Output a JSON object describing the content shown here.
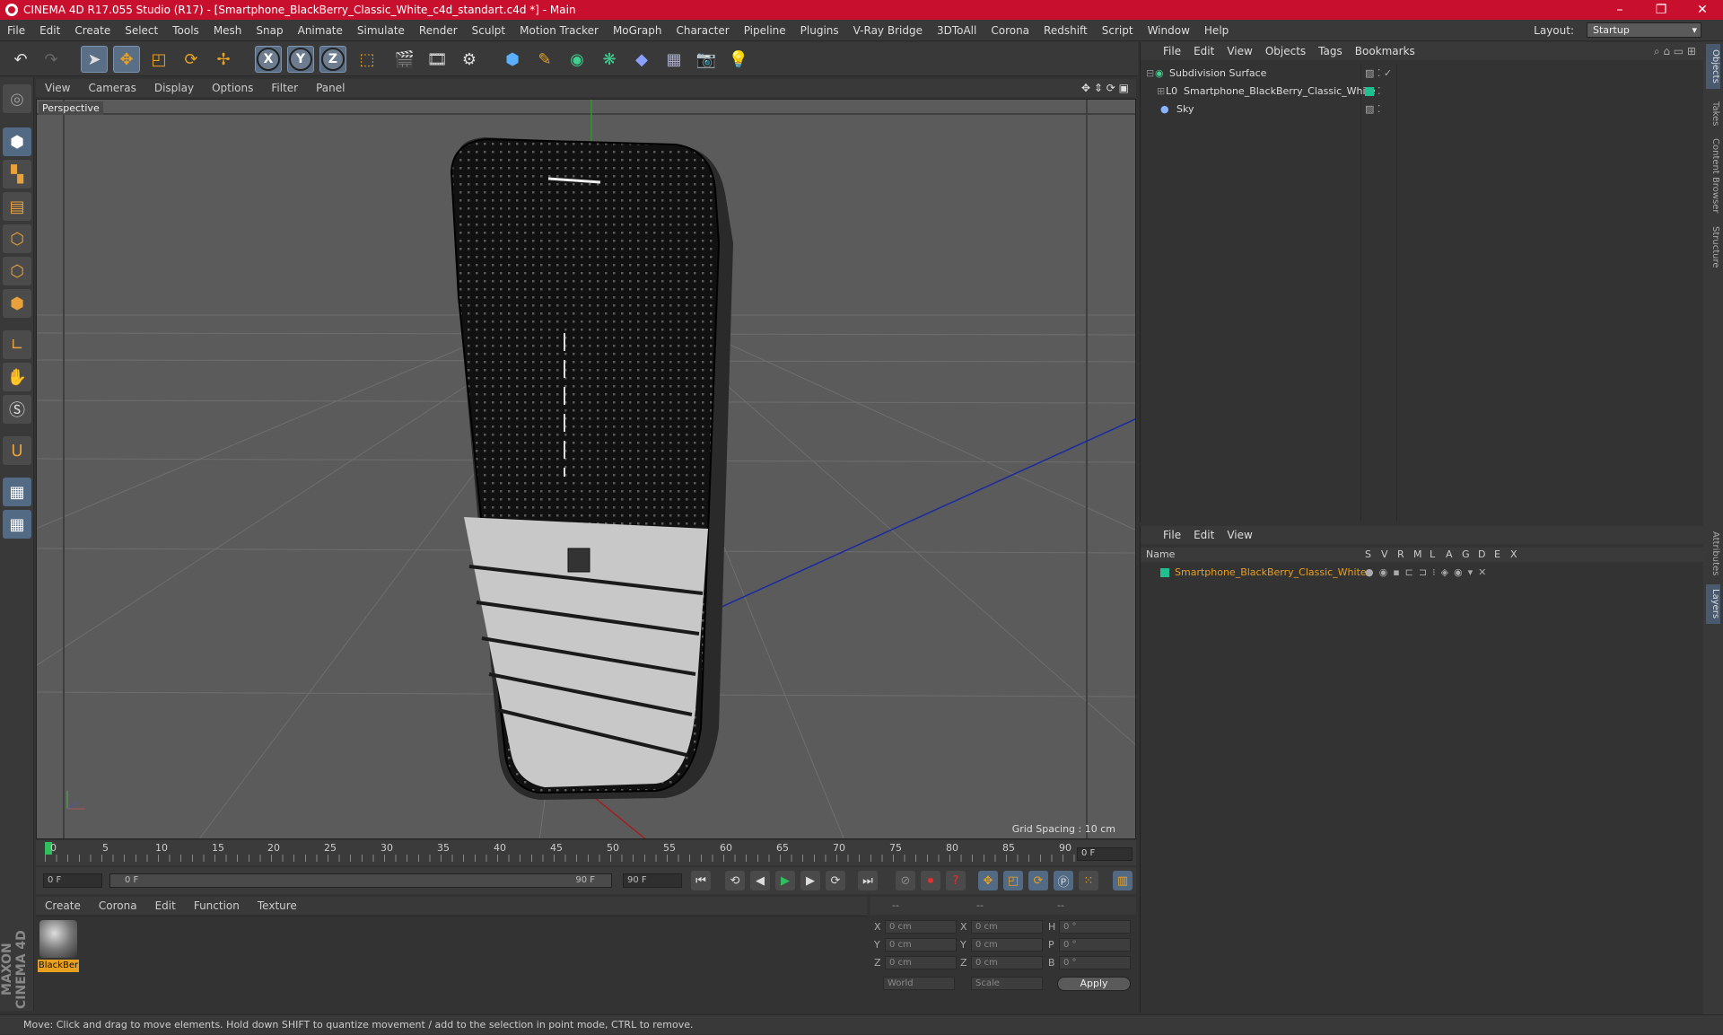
{
  "title": "CINEMA 4D R17.055 Studio (R17) - [Smartphone_BlackBerry_Classic_White_c4d_standart.c4d *] - Main",
  "menu": [
    "File",
    "Edit",
    "Create",
    "Select",
    "Tools",
    "Mesh",
    "Snap",
    "Animate",
    "Simulate",
    "Render",
    "Sculpt",
    "Motion Tracker",
    "MoGraph",
    "Character",
    "Pipeline",
    "Plugins",
    "V-Ray Bridge",
    "3DToAll",
    "Corona",
    "Redshift",
    "Script",
    "Window",
    "Help"
  ],
  "layout": {
    "label": "Layout:",
    "value": "Startup"
  },
  "axes": [
    "X",
    "Y",
    "Z"
  ],
  "viewport": {
    "menu": [
      "View",
      "Cameras",
      "Display",
      "Options",
      "Filter",
      "Panel"
    ],
    "label": "Perspective",
    "grid_spacing": "Grid Spacing : 10 cm"
  },
  "timeline": {
    "ticks": [
      "0",
      "5",
      "10",
      "15",
      "20",
      "25",
      "30",
      "35",
      "40",
      "45",
      "50",
      "55",
      "60",
      "65",
      "70",
      "75",
      "80",
      "85",
      "90"
    ],
    "current_frame": "0 F",
    "start": "0 F",
    "slider_start": "0 F",
    "slider_end": "90 F",
    "end": "90 F"
  },
  "material": {
    "menu": [
      "Create",
      "Corona",
      "Edit",
      "Function",
      "Texture"
    ],
    "name": "BlackBer"
  },
  "coords": {
    "header": [
      "--",
      "--",
      "--"
    ],
    "rows": [
      {
        "a": "X",
        "v1": "0 cm",
        "b": "X",
        "v2": "0 cm",
        "c": "H",
        "v3": "0 °"
      },
      {
        "a": "Y",
        "v1": "0 cm",
        "b": "Y",
        "v2": "0 cm",
        "c": "P",
        "v3": "0 °"
      },
      {
        "a": "Z",
        "v1": "0 cm",
        "b": "Z",
        "v2": "0 cm",
        "c": "B",
        "v3": "0 °"
      }
    ],
    "world": "World",
    "scale": "Scale",
    "apply": "Apply"
  },
  "objects": {
    "menu": [
      "File",
      "Edit",
      "View",
      "Objects",
      "Tags",
      "Bookmarks"
    ],
    "items": [
      "Subdivision Surface",
      "Smartphone_BlackBerry_Classic_White",
      "Sky"
    ]
  },
  "layers": {
    "menu": [
      "File",
      "Edit",
      "View"
    ],
    "columns": [
      "Name",
      "S",
      "V",
      "R",
      "M",
      "L",
      "A",
      "G",
      "D",
      "E",
      "X"
    ],
    "item": "Smartphone_BlackBerry_Classic_White"
  },
  "sidetabs": [
    "Objects",
    "Takes",
    "Content Browser",
    "Structure",
    "Attributes",
    "Layers"
  ],
  "brand": "MAXON CINEMA 4D",
  "status": "Move: Click and drag to move elements. Hold down SHIFT to quantize movement / add to the selection in point mode, CTRL to remove.",
  "colors": {
    "title_bar": "#c8102e",
    "accent_orange": "#e8a020",
    "layer_color": "#1fbf8f"
  }
}
